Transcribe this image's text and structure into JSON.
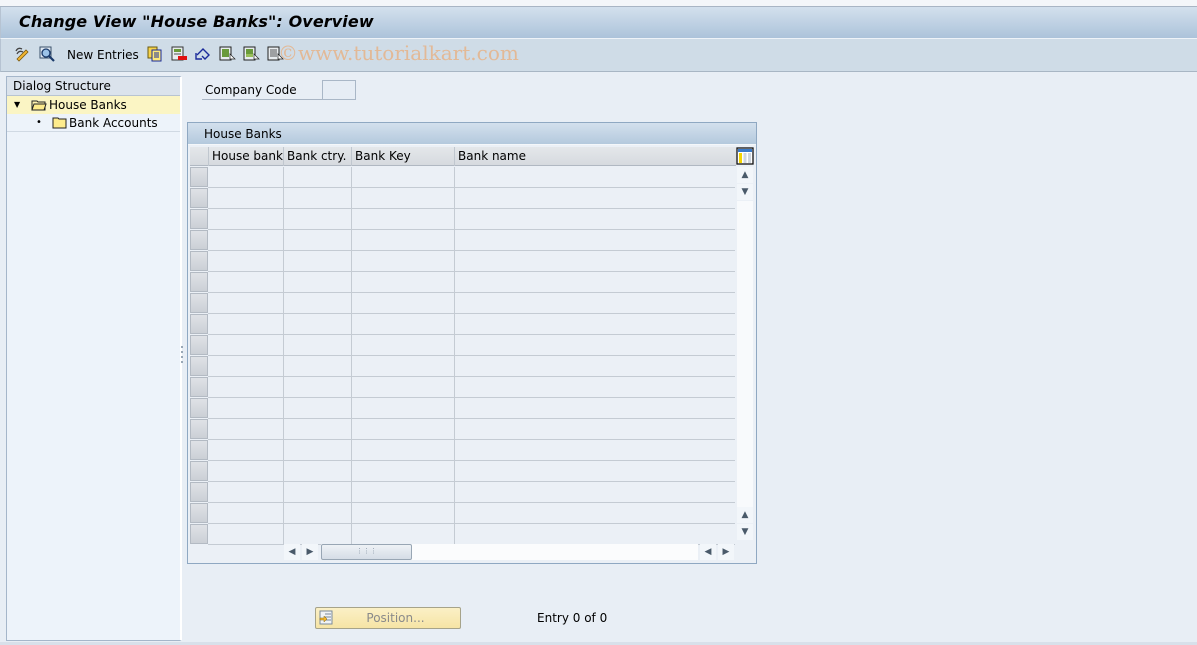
{
  "window": {
    "title": "Change View \"House Banks\": Overview",
    "watermark": "©www.tutorialkart.com"
  },
  "toolbar": {
    "items": [
      {
        "icon": "display-change-icon",
        "label": ""
      },
      {
        "icon": "details-icon",
        "label": ""
      },
      {
        "icon": "",
        "label": "New Entries"
      },
      {
        "icon": "copy-as-icon",
        "label": ""
      },
      {
        "icon": "delete-icon",
        "label": ""
      },
      {
        "icon": "undo-change-icon",
        "label": ""
      },
      {
        "icon": "select-all-icon",
        "label": ""
      },
      {
        "icon": "select-block-icon",
        "label": ""
      },
      {
        "icon": "deselect-all-icon",
        "label": ""
      }
    ],
    "new_entries_label": "New Entries"
  },
  "dialog_structure": {
    "header": "Dialog Structure",
    "items": [
      {
        "label": "House Banks",
        "selected": true,
        "expanded": true,
        "level": 0
      },
      {
        "label": "Bank Accounts",
        "selected": false,
        "expanded": false,
        "level": 1
      }
    ]
  },
  "filter": {
    "company_code_label": "Company Code",
    "company_code_value": ""
  },
  "table": {
    "title": "House Banks",
    "columns": [
      "House bank",
      "Bank ctry.",
      "Bank Key",
      "Bank name"
    ],
    "rows": [],
    "visible_empty_rows": 18
  },
  "footer": {
    "position_button": "Position...",
    "entry_info": "Entry 0 of 0"
  }
}
